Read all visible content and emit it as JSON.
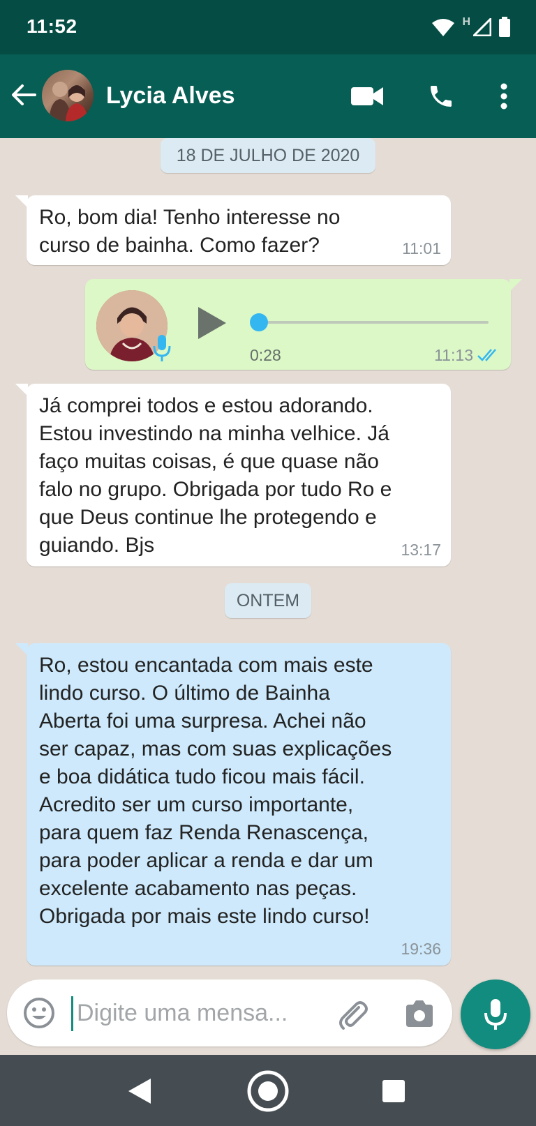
{
  "status_bar": {
    "time": "11:52",
    "network_label": "H"
  },
  "header": {
    "contact_name": "Lycia Alves"
  },
  "chat": {
    "date_chips": [
      {
        "label": "18 DE JULHO DE 2020"
      },
      {
        "label": "ONTEM"
      }
    ],
    "messages": [
      {
        "direction": "in",
        "text": "Ro, bom dia! Tenho interesse no\ncurso de bainha. Como fazer?",
        "time": "11:01"
      },
      {
        "direction": "out",
        "type": "voice",
        "duration": "0:28",
        "time": "11:13",
        "progress": 0.0,
        "read": true
      },
      {
        "direction": "in",
        "text": "Já comprei todos e estou adorando.\nEstou investindo na minha velhice. Já\nfaço muitas coisas, é que quase não\nfalo no grupo. Obrigada por tudo Ro e\nque Deus continue lhe protegendo e\nguiando. Bjs",
        "time": "13:17"
      },
      {
        "direction": "in",
        "highlighted": true,
        "text": "Ro, estou encantada com mais este\nlindo curso. O último de Bainha\nAberta foi uma surpresa. Achei não\nser capaz, mas com suas explicações\ne boa didática tudo ficou mais fácil.\nAcredito ser um curso importante,\npara quem faz Renda Renascença,\npara poder aplicar a renda e dar um\nexcelente acabamento nas peças.\nObrigada por mais este lindo curso!",
        "time": "19:36"
      }
    ]
  },
  "composer": {
    "placeholder": "Digite uma mensa..."
  },
  "colors": {
    "toolbar": "#075e54",
    "status_bar": "#054d44",
    "accent": "#128c7e",
    "outgoing": "#dcf8c6",
    "highlight": "#cde9fb",
    "read_ticks": "#34b7f1"
  }
}
